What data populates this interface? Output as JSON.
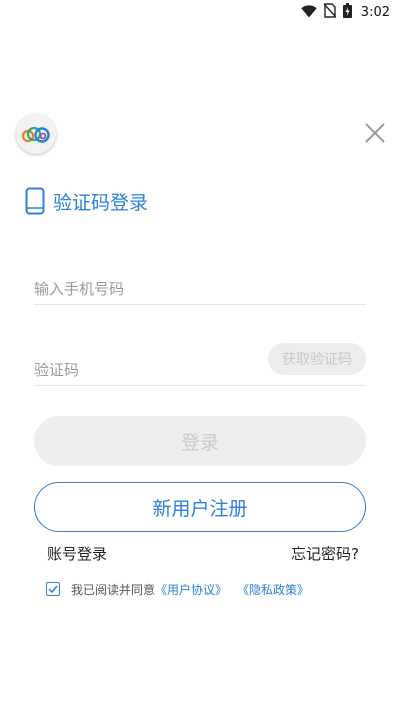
{
  "status_bar": {
    "time": "3:02",
    "icons": [
      "wifi-icon",
      "no-sim-icon",
      "battery-charging-icon"
    ]
  },
  "header": {
    "logo_icon": "cloud-logo-icon",
    "close_icon": "close-icon"
  },
  "login_form": {
    "title": "验证码登录",
    "title_icon": "mobile-phone-icon",
    "phone_placeholder": "输入手机号码",
    "phone_value": "",
    "code_placeholder": "验证码",
    "code_value": "",
    "get_code_label": "获取验证码",
    "login_label": "登录",
    "register_label": "新用户注册",
    "account_login_label": "账号登录",
    "forgot_password_label": "忘记密码?"
  },
  "agreement": {
    "checked": true,
    "prefix": "我已阅读并同意",
    "user_agreement": "《用户协议》",
    "privacy_policy": "《隐私政策》"
  },
  "colors": {
    "accent": "#2e7fd8",
    "disabled_bg": "#eeeeee",
    "disabled_text": "#c9c9c9"
  }
}
